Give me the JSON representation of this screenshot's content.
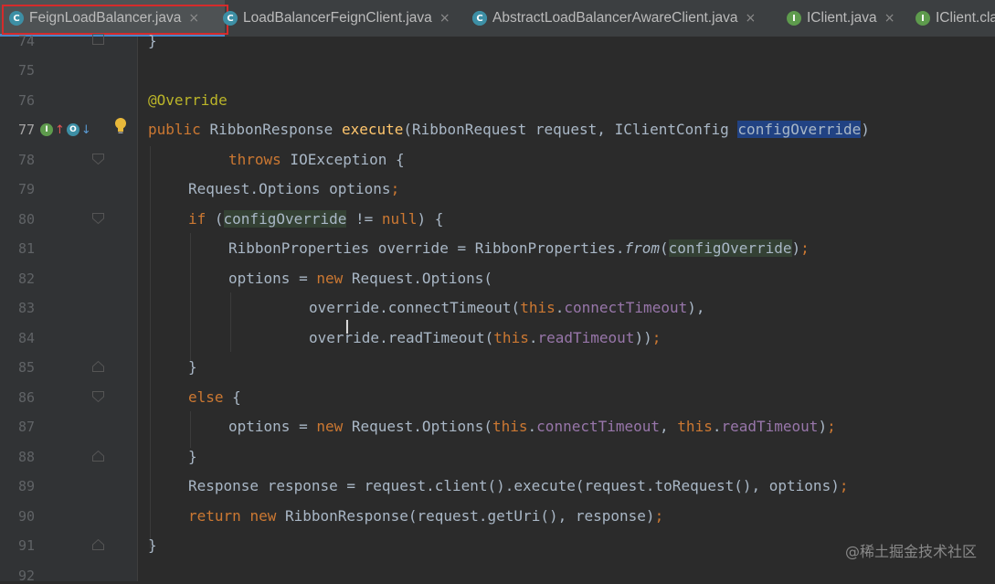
{
  "tabs": [
    {
      "label": "FeignLoadBalancer.java",
      "icon": "class-icon",
      "active": true
    },
    {
      "label": "LoadBalancerFeignClient.java",
      "icon": "class-icon"
    },
    {
      "label": "AbstractLoadBalancerAwareClient.java",
      "icon": "abstract-class-icon"
    },
    {
      "label": "IClient.java",
      "icon": "interface-icon"
    },
    {
      "label": "IClient.cla",
      "icon": "interface-icon"
    }
  ],
  "close_glyph": "×",
  "line_numbers": [
    "74",
    "75",
    "76",
    "77",
    "78",
    "79",
    "80",
    "81",
    "82",
    "83",
    "84",
    "85",
    "86",
    "87",
    "88",
    "89",
    "90",
    "91",
    "92"
  ],
  "code": {
    "l74": "}",
    "l76_ann": "@Override",
    "l77_kw": "public",
    "l77_type": "RibbonResponse",
    "l77_fn": "execute",
    "l77_args": "(RibbonRequest request, IClientConfig ",
    "l77_sel": "configOverride",
    "l77_end": ")",
    "l78_kw": "throws",
    "l78_rest": " IOException {",
    "l79": "Request.Options options",
    "l79_semi": ";",
    "l80_kw": "if",
    "l80_open": " (",
    "l80_hl": "configOverride",
    "l80_mid": " != ",
    "l80_null": "null",
    "l80_end": ") {",
    "l81_a": "RibbonProperties override = RibbonProperties.",
    "l81_from": "from",
    "l81_open": "(",
    "l81_hl": "configOverride",
    "l81_end": ")",
    "l81_semi": ";",
    "l82_a": "options = ",
    "l82_new": "new",
    "l82_b": " Request.Options(",
    "l83_a": "override.connectTimeout(",
    "l83_this": "this",
    "l83_dot": ".",
    "l83_fld": "connectTimeout",
    "l83_end": "),",
    "l84_a": "override.readTimeout(",
    "l84_this": "this",
    "l84_dot": ".",
    "l84_fld": "readTimeout",
    "l84_end": "))",
    "l84_semi": ";",
    "l85": "}",
    "l86_kw": "else",
    "l86_rest": " {",
    "l87_a": "options = ",
    "l87_new": "new",
    "l87_b": " Request.Options(",
    "l87_this1": "this",
    "l87_dot1": ".",
    "l87_fld1": "connectTimeout",
    "l87_comma": ", ",
    "l87_this2": "this",
    "l87_dot2": ".",
    "l87_fld2": "readTimeout",
    "l87_end": ")",
    "l87_semi": ";",
    "l88": "}",
    "l89_a": "Response response = request.client().execute(request.toRequest(), options)",
    "l89_semi": ";",
    "l90_ret": "return",
    "l90_new": "new",
    "l90_a": " RibbonResponse(request.getUri(), response)",
    "l90_semi": ";",
    "l91": "}"
  },
  "watermark": "@稀土掘金技术社区",
  "colors": {
    "keyword": "#cc7832",
    "annotation": "#bbb529",
    "method": "#ffc66d",
    "field": "#9876aa",
    "text": "#a9b7c6",
    "selection": "#214283"
  }
}
